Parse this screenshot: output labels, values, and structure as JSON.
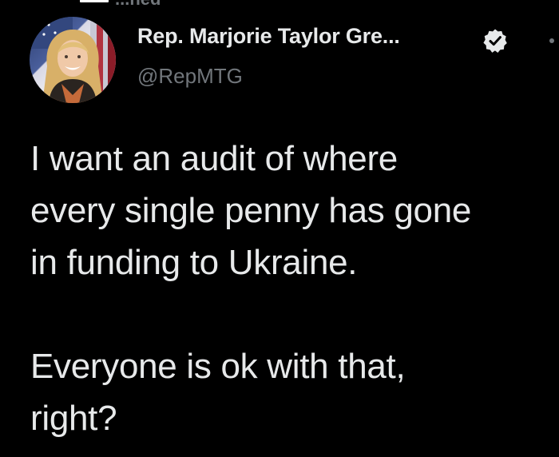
{
  "pinned": {
    "label": "...ned"
  },
  "author": {
    "display_name": "Rep. Marjorie Taylor Gre...",
    "handle": "@RepMTG",
    "verified": true,
    "avatar": "avatar-portrait"
  },
  "tweet": {
    "paragraphs": [
      "I want an audit of where\nevery single penny has gone\nin funding to Ukraine.",
      "Everyone is ok with that,\nright?"
    ]
  },
  "icons": {
    "verified": "verified-badge-icon",
    "more": "more-options-icon",
    "flag": "us-flag-icon"
  },
  "colors": {
    "background": "#000000",
    "text_primary": "#e7e9ea",
    "text_secondary": "#71767b"
  }
}
